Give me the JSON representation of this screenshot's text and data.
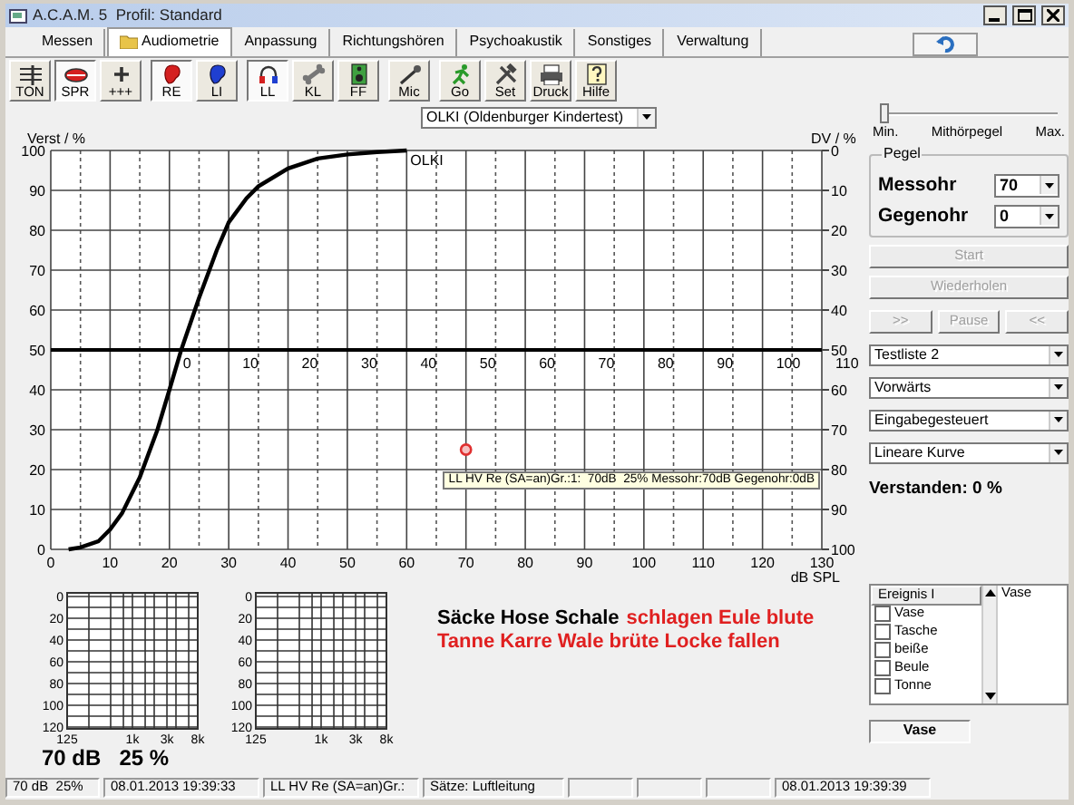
{
  "window": {
    "title": "A.C.A.M. 5  Profil: Standard"
  },
  "tabs": [
    {
      "label": "Messen",
      "selected": false
    },
    {
      "label": "Audiometrie",
      "selected": true
    },
    {
      "label": "Anpassung",
      "selected": false
    },
    {
      "label": "Richtungshören",
      "selected": false
    },
    {
      "label": "Psychoakustik",
      "selected": false
    },
    {
      "label": "Sonstiges",
      "selected": false
    },
    {
      "label": "Verwaltung",
      "selected": false
    }
  ],
  "toolbar": [
    {
      "buttons": [
        {
          "label": "TON",
          "pressed": false
        },
        {
          "label": "SPR",
          "pressed": true
        },
        {
          "label": "+++",
          "pressed": false
        }
      ]
    },
    {
      "buttons": [
        {
          "label": "RE",
          "pressed": true
        },
        {
          "label": "LI",
          "pressed": false
        }
      ]
    },
    {
      "buttons": [
        {
          "label": "LL",
          "pressed": true
        },
        {
          "label": "KL",
          "pressed": false
        },
        {
          "label": "FF",
          "pressed": false
        }
      ]
    },
    {
      "buttons": [
        {
          "label": "Mic",
          "pressed": false
        }
      ]
    },
    {
      "buttons": [
        {
          "label": "Go",
          "pressed": false
        },
        {
          "label": "Set",
          "pressed": false
        },
        {
          "label": "Druck",
          "pressed": false
        },
        {
          "label": "Hilfe",
          "pressed": false
        }
      ]
    }
  ],
  "test_select": {
    "value": "OLKI (Oldenburger Kindertest)"
  },
  "chart": {
    "chart_data": {
      "type": "line",
      "xlabel": "dB SPL",
      "ylabel": "Verst / %",
      "x": [
        3,
        5,
        8,
        10,
        12,
        15,
        18,
        20,
        22,
        25,
        28,
        30,
        33,
        35,
        40,
        45,
        50,
        55,
        60
      ],
      "series": [
        {
          "name": "OLKI",
          "color": "#000000",
          "values": [
            0,
            0.5,
            2,
            5,
            9,
            18,
            30,
            40,
            50,
            63,
            75,
            82,
            88,
            91,
            95.5,
            98,
            99,
            99.6,
            100
          ]
        }
      ],
      "xlim": [
        0,
        130
      ],
      "ylim": [
        0,
        100
      ],
      "xticks": [
        0,
        10,
        20,
        30,
        40,
        50,
        60,
        70,
        80,
        90,
        100,
        110,
        120,
        130
      ],
      "yticks": [
        0,
        10,
        20,
        30,
        40,
        50,
        60,
        70,
        80,
        90,
        100
      ],
      "grid": true,
      "ref_lines": [
        {
          "axis": "y",
          "value": 50
        }
      ],
      "annotations": [
        {
          "x": 70,
          "y": 25,
          "text": "LL HV Re (SA=an)Gr.:1:  70dB  25% Messohr:70dB Gegenohr:0dB"
        }
      ]
    },
    "right_axis": {
      "label": "DV / %",
      "labels": [
        "0",
        "10",
        "20",
        "30",
        "40",
        "50",
        "60",
        "70",
        "80",
        "90",
        "100"
      ]
    },
    "mid_axis": {
      "labels": [
        "0",
        "10",
        "20",
        "30",
        "40",
        "50",
        "60",
        "70",
        "80",
        "90",
        "100",
        "110"
      ]
    }
  },
  "audiograms": [
    {
      "y_labels": [
        "0",
        "20",
        "40",
        "60",
        "80",
        "100",
        "120"
      ],
      "x_labels": [
        "125",
        "1k",
        "3k",
        "8k"
      ]
    },
    {
      "y_labels": [
        "0",
        "20",
        "40",
        "60",
        "80",
        "100",
        "120"
      ],
      "x_labels": [
        "125",
        "1k",
        "3k",
        "8k"
      ]
    }
  ],
  "result": {
    "db": "70 dB",
    "percent": "25 %"
  },
  "sentence": [
    [
      {
        "text": "Säcke Hose Schale",
        "color": "#000000"
      },
      {
        "text": "schlagen Eule blute",
        "color": "#e02020"
      }
    ],
    [
      {
        "text": "Tanne Karre Wale brüte Locke fallen",
        "color": "#e02020"
      }
    ]
  ],
  "mithoerpegel": {
    "min_label": "Min.",
    "label": "Mithörpegel",
    "max_label": "Max.",
    "level": 0
  },
  "pegel": {
    "title": "Pegel",
    "fields": [
      {
        "label": "Messohr",
        "value": "70"
      },
      {
        "label": "Gegenohr",
        "value": "0"
      }
    ]
  },
  "buttons": [
    {
      "label": "Start",
      "disabled": true
    },
    {
      "label": "Wiederholen",
      "disabled": true
    }
  ],
  "nav_buttons": [
    {
      "label": ">>",
      "disabled": true
    },
    {
      "label": "Pause",
      "disabled": true
    },
    {
      "label": "<<",
      "disabled": true
    }
  ],
  "selects": [
    {
      "value": "Testliste 2"
    },
    {
      "value": "Vorwärts"
    },
    {
      "value": "Eingabegesteuert"
    },
    {
      "value": "Lineare Kurve"
    }
  ],
  "verstanden": "Verstanden: 0 %",
  "word_list": {
    "header": "Ereignis I",
    "items": [
      {
        "label": "Vase",
        "checked": false
      },
      {
        "label": "Tasche",
        "checked": false
      },
      {
        "label": "beiße",
        "checked": false
      },
      {
        "label": "Beule",
        "checked": false
      },
      {
        "label": "Tonne",
        "checked": false
      }
    ],
    "side_text": "Vase"
  },
  "current_word": "Vase",
  "status_bar": [
    {
      "kind": "text",
      "text": "70 dB  25%"
    },
    {
      "kind": "text",
      "text": "08.01.2013 19:39:33"
    },
    {
      "kind": "text",
      "text": "LL HV Re (SA=an)Gr.:"
    },
    {
      "kind": "text",
      "text": "Sätze: Luftleitung"
    },
    {
      "kind": "empty"
    },
    {
      "kind": "empty"
    },
    {
      "kind": "empty"
    },
    {
      "kind": "text",
      "text": "08.01.2013 19:39:39"
    }
  ]
}
